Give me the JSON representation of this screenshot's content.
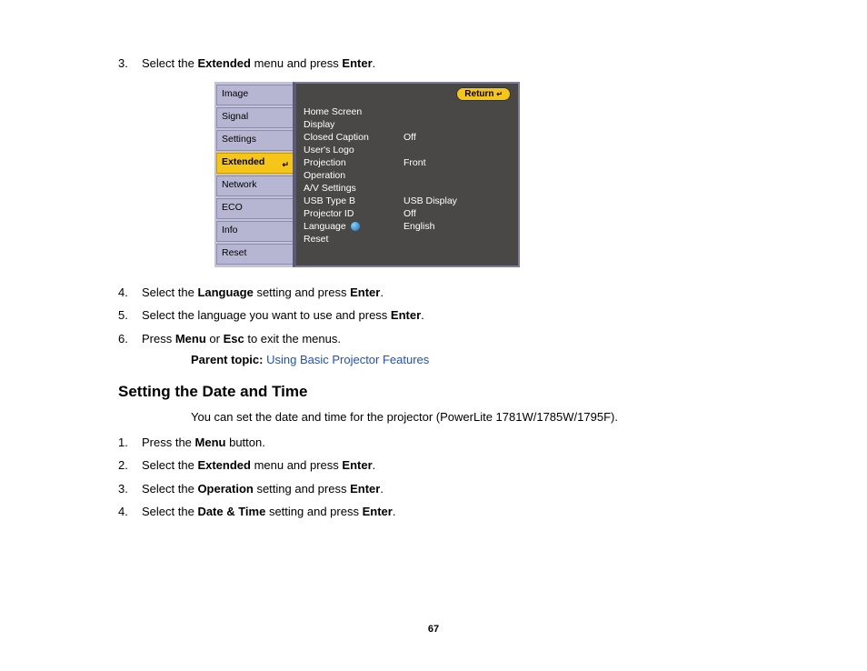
{
  "top_steps": [
    {
      "n": "3.",
      "parts": [
        "Select the ",
        {
          "b": "Extended"
        },
        " menu and press ",
        {
          "b": "Enter"
        },
        "."
      ]
    }
  ],
  "menu": {
    "tabs": [
      "Image",
      "Signal",
      "Settings",
      "Extended",
      "Network",
      "ECO",
      "Info",
      "Reset"
    ],
    "selected_tab": "Extended",
    "return_label": "Return",
    "rows": [
      {
        "label": "Home Screen",
        "value": ""
      },
      {
        "label": "Display",
        "value": ""
      },
      {
        "label": "Closed Caption",
        "value": "Off"
      },
      {
        "label": "User's Logo",
        "value": ""
      },
      {
        "label": "Projection",
        "value": "Front"
      },
      {
        "label": "Operation",
        "value": ""
      },
      {
        "label": "A/V Settings",
        "value": ""
      },
      {
        "label": "USB Type B",
        "value": "USB Display"
      },
      {
        "label": "Projector ID",
        "value": "Off"
      },
      {
        "label": "Language",
        "value": "English",
        "globe": true
      },
      {
        "label": "Reset",
        "value": ""
      }
    ]
  },
  "mid_steps": [
    {
      "n": "4.",
      "parts": [
        "Select the ",
        {
          "b": "Language"
        },
        " setting and press ",
        {
          "b": "Enter"
        },
        "."
      ]
    },
    {
      "n": "5.",
      "parts": [
        "Select the language you want to use and press ",
        {
          "b": "Enter"
        },
        "."
      ]
    },
    {
      "n": "6.",
      "parts": [
        "Press ",
        {
          "b": "Menu"
        },
        " or ",
        {
          "b": "Esc"
        },
        " to exit the menus."
      ]
    }
  ],
  "parent_topic": {
    "label": "Parent topic:",
    "link": "Using Basic Projector Features"
  },
  "section_heading": "Setting the Date and Time",
  "section_intro": "You can set the date and time for the projector (PowerLite 1781W/1785W/1795F).",
  "section_steps": [
    {
      "n": "1.",
      "parts": [
        "Press the ",
        {
          "b": "Menu"
        },
        " button."
      ]
    },
    {
      "n": "2.",
      "parts": [
        "Select the ",
        {
          "b": "Extended"
        },
        " menu and press ",
        {
          "b": "Enter"
        },
        "."
      ]
    },
    {
      "n": "3.",
      "parts": [
        "Select the ",
        {
          "b": "Operation"
        },
        " setting and press ",
        {
          "b": "Enter"
        },
        "."
      ]
    },
    {
      "n": "4.",
      "parts": [
        "Select the ",
        {
          "b": "Date & Time"
        },
        " setting and press ",
        {
          "b": "Enter"
        },
        "."
      ]
    }
  ],
  "page_number": "67"
}
